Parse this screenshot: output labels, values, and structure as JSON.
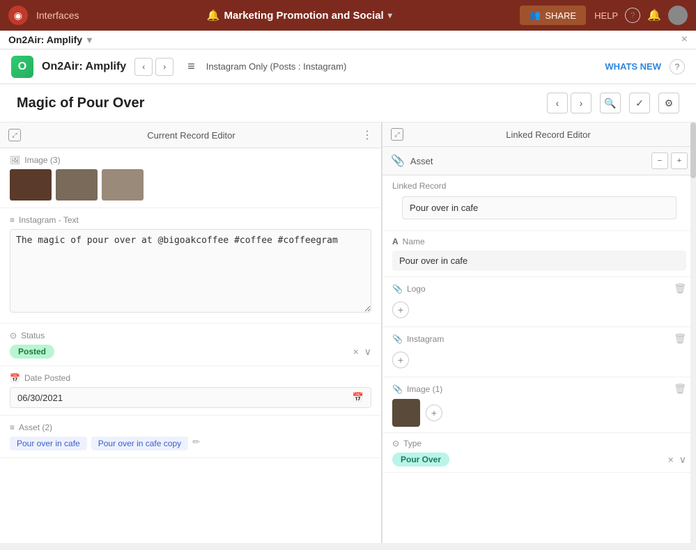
{
  "topNav": {
    "logo_symbol": "◉",
    "interfaces_label": "Interfaces",
    "title": "Marketing Promotion and Social",
    "title_icon": "🔔",
    "share_label": "SHARE",
    "share_icon": "👥",
    "help_label": "HELP",
    "close_icon": "×"
  },
  "subBar": {
    "title": "On2Air: Amplify",
    "chevron": "▼"
  },
  "appHeader": {
    "logo_text": "O",
    "app_name": "On2Air: Amplify",
    "prev_arrow": "‹",
    "next_arrow": "›",
    "hamburger": "≡",
    "path": "Instagram Only  (Posts : Instagram)",
    "whats_new": "WHATS NEW",
    "help_icon": "?"
  },
  "pageTitle": {
    "title": "Magic of Pour Over",
    "prev_arrow": "‹",
    "next_arrow": "›",
    "search_icon": "🔍",
    "check_icon": "✓",
    "gear_icon": "⚙"
  },
  "leftPanel": {
    "header": "Current Record Editor",
    "expand_icon": "⤢",
    "menu_icon": "⋮",
    "fields": {
      "image_label": "Image (3)",
      "instagram_text_label": "Instagram - Text",
      "instagram_text_value": "The magic of pour over at @bigoakcoffee #coffee #coffeegram",
      "status_label": "Status",
      "status_value": "Posted",
      "date_posted_label": "Date Posted",
      "date_posted_value": "06/30/2021",
      "asset_label": "Asset (2)",
      "asset_tag_1": "Pour over in cafe",
      "asset_tag_2": "Pour over in cafe copy"
    }
  },
  "rightPanel": {
    "header": "Linked Record Editor",
    "expand_icon": "⤢",
    "asset_title": "Asset",
    "prev_arrow": "−",
    "next_arrow": "+",
    "linked_record_label": "Linked Record",
    "linked_record_value": "Pour over in cafe",
    "fields": {
      "name_label": "Name",
      "name_value": "Pour over in cafe",
      "logo_label": "Logo",
      "logo_add": "+",
      "instagram_label": "Instagram",
      "instagram_add": "+",
      "image_label": "Image (1)",
      "image_add": "+",
      "type_label": "Type",
      "type_value": "Pour Over"
    }
  },
  "icons": {
    "list_icon": "≡",
    "image_icon": "🖼",
    "calendar_icon": "📅",
    "attachment_icon": "📎",
    "shield_icon": "⊙",
    "text_icon": "T",
    "name_icon": "A",
    "trash_icon": "🗑"
  }
}
